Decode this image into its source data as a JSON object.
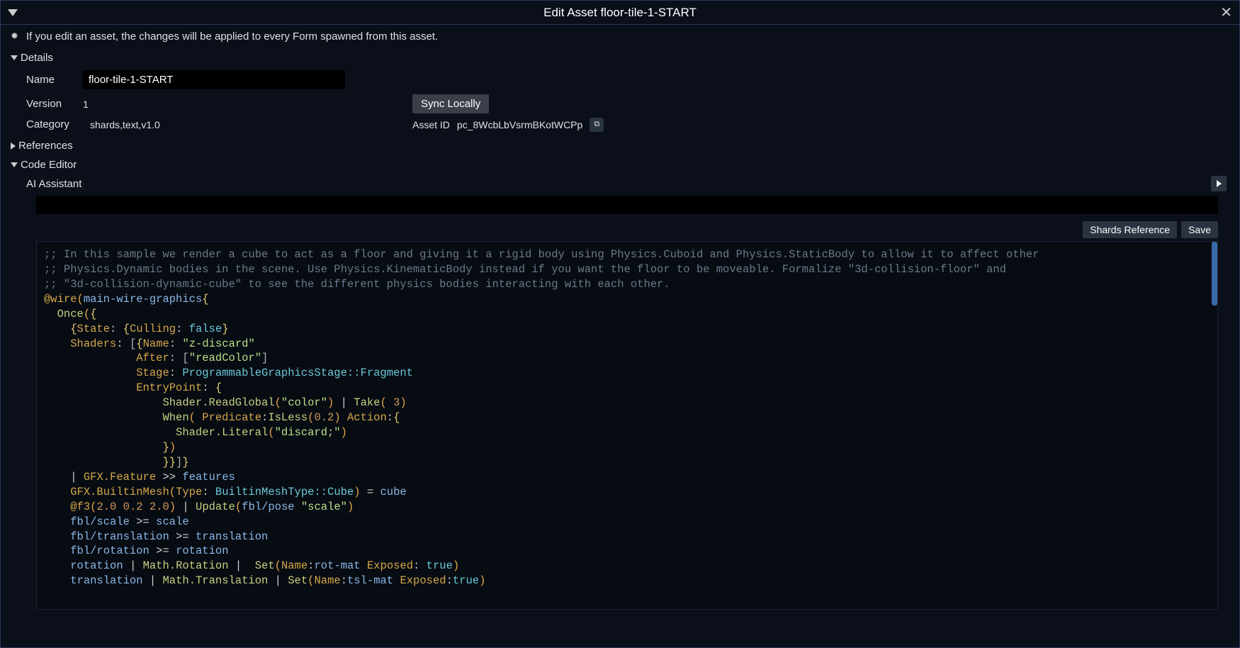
{
  "titlebar": {
    "title": "Edit Asset floor-tile-1-START"
  },
  "info": "If you edit an asset, the changes will be applied to every Form spawned from this asset.",
  "sections": {
    "details": "Details",
    "references": "References",
    "code_editor": "Code Editor"
  },
  "details": {
    "name_label": "Name",
    "name_value": "floor-tile-1-START",
    "version_label": "Version",
    "version_value": "1",
    "sync_button": "Sync Locally",
    "category_label": "Category",
    "category_value": "shards,text,v1.0",
    "asset_id_label": "Asset ID",
    "asset_id_value": "pc_8WcbLbVsrmBKotWCPp"
  },
  "code_editor": {
    "ai_assistant_label": "AI Assistant",
    "shards_ref_button": "Shards Reference",
    "save_button": "Save"
  },
  "code": {
    "comment1": ";; In this sample we render a cube to act as a floor and giving it a rigid body using Physics.Cuboid and Physics.StaticBody to allow it to affect other",
    "comment2": ";; Physics.Dynamic bodies in the scene. Use Physics.KinematicBody instead if you want the floor to be moveable. Formalize \"3d-collision-floor\" and",
    "comment3": ";; \"3d-collision-dynamic-cube\" to see the different physics bodies interacting with each other.",
    "wire": "@wire",
    "wire_name": "main-wire-graphics",
    "once": "Once",
    "state": "State",
    "culling": "Culling",
    "false": "false",
    "shaders": "Shaders",
    "name": "Name",
    "zdiscard": "\"z-discard\"",
    "after": "After",
    "readcolor": "\"readColor\"",
    "stage": "Stage",
    "stage_val": "ProgrammableGraphicsStage::Fragment",
    "entrypoint": "EntryPoint",
    "shader_readglobal": "Shader.ReadGlobal",
    "color_str": "\"color\"",
    "take": "Take",
    "three": "3",
    "when": "When",
    "predicate": "Predicate",
    "isless": "IsLess",
    "point2": "0.2",
    "action": "Action",
    "shader_literal": "Shader.Literal",
    "discard_str": "\"discard;\"",
    "gfx_feature": "GFX.Feature",
    "features": "features",
    "gfx_builtinmesh": "GFX.BuiltinMesh",
    "type": "Type",
    "builtin_cube": "BuiltinMeshType::Cube",
    "cube": "cube",
    "f3": "@f3",
    "f3_vals": "2.0 0.2 2.0",
    "update": "Update",
    "fbl_pose": "fbl/pose",
    "scale_str": "\"scale\"",
    "fbl_scale": "fbl/scale",
    "scale": "scale",
    "fbl_translation": "fbl/translation",
    "translation": "translation",
    "fbl_rotation": "fbl/rotation",
    "rotation": "rotation",
    "math_rotation": "Math.Rotation",
    "set": "Set",
    "rotmat": "rot-mat",
    "exposed": "Exposed",
    "true": "true",
    "math_translation": "Math.Translation",
    "tslmat": "tsl-mat"
  }
}
